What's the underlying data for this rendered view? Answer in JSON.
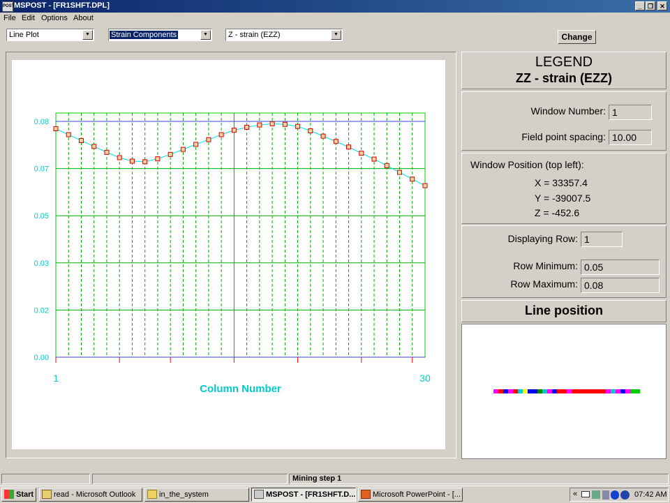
{
  "window": {
    "title": "MSPOST - [FR1SHFT.DPL]"
  },
  "menu": [
    "File",
    "Edit",
    "Options",
    "About"
  ],
  "toolbar": {
    "plot_type": "Line Plot",
    "component_group": "Strain Components",
    "component": "Z - strain (EZZ)",
    "change_label": "Change"
  },
  "legend": {
    "title": "LEGEND",
    "subtitle": "ZZ - strain (EZZ)"
  },
  "window_info": {
    "number_label": "Window Number:",
    "number": "1",
    "spacing_label": "Field point spacing:",
    "spacing": "10.00"
  },
  "position": {
    "title": "Window Position (top left):",
    "x": "X = 33357.4",
    "y": "Y = -39007.5",
    "z": "Z = -452.6"
  },
  "row": {
    "displaying_label": "Displaying Row:",
    "displaying": "1",
    "min_label": "Row Minimum:",
    "min": "0.05",
    "max_label": "Row Maximum:",
    "max": "0.08"
  },
  "line_position": {
    "title": "Line position",
    "colors": [
      "#ff00ff",
      "#ff0000",
      "#0000ff",
      "#ff00ff",
      "#ff0000",
      "#00cccc",
      "#ffff00",
      "#0000ff",
      "#0000ff",
      "#008800",
      "#00cccc",
      "#ff00ff",
      "#0000ff",
      "#ff0000",
      "#ff0000",
      "#ff00ff",
      "#ff0000",
      "#ff0000",
      "#ff0000",
      "#ff0000",
      "#ff0000",
      "#ff0000",
      "#ff0000",
      "#ff00ff",
      "#00cccc",
      "#ff00ff",
      "#0000ff",
      "#ff00ff",
      "#00cc00",
      "#00cc00"
    ]
  },
  "chart_data": {
    "type": "line",
    "xlabel": "Column Number",
    "ylabel": "",
    "xlim": [
      1,
      30
    ],
    "ylim": [
      0.0,
      0.08
    ],
    "x_ticklabels": [
      "1",
      "30"
    ],
    "y_ticklabels": [
      "0.00",
      "0.02",
      "0.03",
      "0.05",
      "0.07",
      "0.08"
    ],
    "x": [
      1,
      2,
      3,
      4,
      5,
      6,
      7,
      8,
      9,
      10,
      11,
      12,
      13,
      14,
      15,
      16,
      17,
      18,
      19,
      20,
      21,
      22,
      23,
      24,
      25,
      26,
      27,
      28,
      29,
      30
    ],
    "series": [
      {
        "values": [
          0.0775,
          0.0755,
          0.0735,
          0.0715,
          0.0695,
          0.0677,
          0.0665,
          0.0663,
          0.0673,
          0.0688,
          0.0705,
          0.0722,
          0.0738,
          0.0755,
          0.077,
          0.078,
          0.0788,
          0.0792,
          0.079,
          0.0783,
          0.0768,
          0.075,
          0.0732,
          0.0713,
          0.0692,
          0.0672,
          0.065,
          0.0627,
          0.0604,
          0.0582
        ]
      }
    ],
    "grid": true
  },
  "status": {
    "text": "Mining step 1"
  },
  "taskbar": {
    "start": "Start",
    "items": [
      "read - Microsoft Outlook",
      "in_the_system",
      "MSPOST - [FR1SHFT.D...",
      "Microsoft PowerPoint - [..."
    ],
    "clock": "07:42 AM"
  }
}
